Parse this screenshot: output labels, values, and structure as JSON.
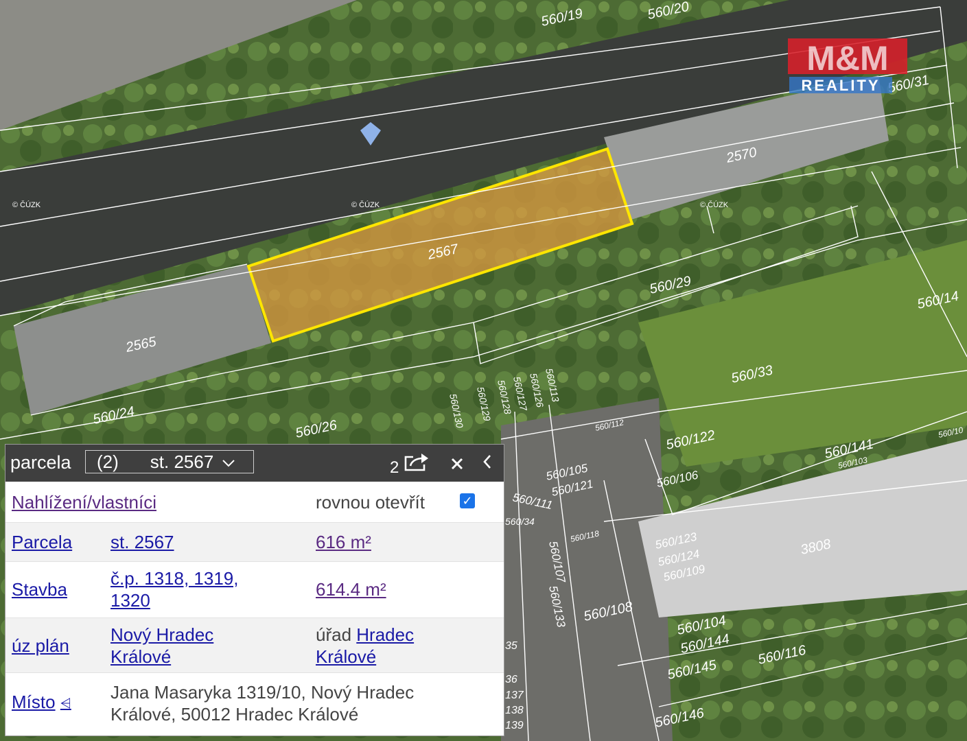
{
  "map": {
    "highlighted_parcel": "2567",
    "watermark": {
      "line1": "M&M",
      "line2": "REALITY"
    },
    "copyright_marks": [
      "© ČÚZK",
      "© ČÚZK",
      "© ČÚZK"
    ],
    "parcel_labels": [
      "560/19",
      "560/20",
      "560/31",
      "2570",
      "2567",
      "2565",
      "560/29",
      "560/14",
      "560/33",
      "560/24",
      "560/26",
      "560/130",
      "560/129",
      "560/128",
      "560/127",
      "560/126",
      "560/113",
      "560/112",
      "560/122",
      "560/141",
      "560/103",
      "560/10",
      "560/105",
      "560/121",
      "560/106",
      "560/111",
      "560/34",
      "560/118",
      "560/123",
      "560/124",
      "560/109",
      "3808",
      "560/107",
      "560/133",
      "560/108",
      "560/104",
      "560/144",
      "560/145",
      "560/116",
      "560/146",
      "35",
      "36",
      "137",
      "138",
      "139"
    ]
  },
  "panel": {
    "type_label": "parcela",
    "select": {
      "count": "(2)",
      "value": "st. 2567"
    },
    "share_count": "2",
    "rows": {
      "nahlizeni": {
        "link": "Nahlížení/vlastníci",
        "option": "rovnou otevřít",
        "checked": true
      },
      "parcela": {
        "label": "Parcela",
        "value": "st. 2567",
        "area": "616 m²"
      },
      "stavba": {
        "label": "Stavba",
        "value": "č.p. 1318, 1319, 1320",
        "area": "614.4 m²"
      },
      "uz_plan": {
        "label": "úz plán",
        "value": "Nový Hradec Králové",
        "office_prefix": "úřad",
        "office": "Hradec Králové"
      },
      "misto": {
        "label": "Místo",
        "value": "Jana Masaryka 1319/10, Nový Hradec Králové, 50012 Hradec Králové"
      }
    }
  },
  "colors": {
    "highlight": "#ffe600",
    "panel_header": "#3f3f3f",
    "link": "#1a1aa6",
    "checkbox": "#1a73e8",
    "watermark_red": "#d8202a"
  }
}
